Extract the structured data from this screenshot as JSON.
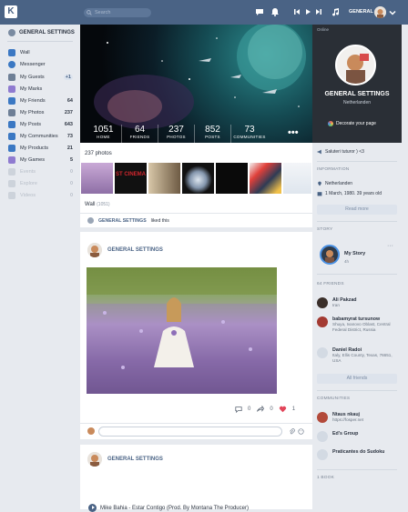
{
  "topbar": {
    "logo": "K",
    "search_placeholder": "Search",
    "username": "GENERAL",
    "colors": {
      "bar": "#4a6385",
      "accent": "#4a6385"
    }
  },
  "sidebar": {
    "user": "GENERAL SETTINGS",
    "items": [
      {
        "label": "Wall",
        "count": "",
        "icon": "wall-icon"
      },
      {
        "label": "Messenger",
        "count": "",
        "icon": "messenger-icon"
      },
      {
        "label": "My Guests",
        "count": "+1",
        "icon": "guests-icon"
      },
      {
        "label": "My Marks",
        "count": "",
        "icon": "marks-icon"
      },
      {
        "label": "My Friends",
        "count": "64",
        "icon": "friends-icon"
      },
      {
        "label": "My Photos",
        "count": "237",
        "icon": "photos-icon"
      },
      {
        "label": "My Posts",
        "count": "643",
        "icon": "posts-icon"
      },
      {
        "label": "My Communities",
        "count": "73",
        "icon": "communities-icon"
      },
      {
        "label": "My Products",
        "count": "21",
        "icon": "products-icon"
      },
      {
        "label": "My Games",
        "count": "5",
        "icon": "games-icon"
      },
      {
        "label": "Events",
        "count": "0",
        "icon": "events-icon"
      },
      {
        "label": "Explore",
        "count": "0",
        "icon": "explore-icon"
      },
      {
        "label": "Videos",
        "count": "0",
        "icon": "videos-icon"
      }
    ]
  },
  "stats": [
    {
      "value": "1051",
      "label": "HOME"
    },
    {
      "value": "64",
      "label": "FRIENDS"
    },
    {
      "value": "237",
      "label": "PHOTOS"
    },
    {
      "value": "852",
      "label": "POSTS"
    },
    {
      "value": "73",
      "label": "COMMUNITIES"
    }
  ],
  "photos_title": "237 photos",
  "wall": {
    "title": "Wall",
    "count": "(1051)"
  },
  "liked": {
    "name": "GENERAL SETTINGS",
    "text": "liked this"
  },
  "post1": {
    "author": "GENERAL SETTINGS",
    "comments": "0",
    "shares": "0",
    "likes": "1"
  },
  "post2": {
    "author": "GENERAL SETTINGS",
    "music": "Mike Bahia - Estar Contigo (Prod. By Montana The Producer)"
  },
  "profile": {
    "status": "Online",
    "name": "GENERAL SETTINGS",
    "location": "Netherlanden",
    "decorate": "Decorate your page"
  },
  "right": {
    "salute": "Saluteri tuturor ) <3",
    "information": "INFORMATION",
    "country": "Netherlanden",
    "birthday": "1 March, 1980. 39 years old",
    "read_more": "Read more",
    "story_title": "STORY",
    "story_name": "My Story",
    "story_time": "4h",
    "friends_title": "64 FRIENDS",
    "friends": [
      {
        "name": "Ali Pakzad",
        "sub": "Iran"
      },
      {
        "name": "babamyrat tursunow",
        "sub": "Shuya, Ivanovo Oblast, Central Federal District, Russia"
      },
      {
        "name": "Daniel Radoi",
        "sub": "Italy, Ellis County, Texas, 76651, USA"
      }
    ],
    "all_friends": "All friends",
    "communities_title": "COMMUNITIES",
    "communities": [
      {
        "name": "Ntaus nkauj",
        "sub": "https://fosper.net"
      },
      {
        "name": "Ed's Group",
        "sub": ""
      },
      {
        "name": "Praticantes do Sudoku",
        "sub": ""
      }
    ],
    "book_title": "1 BOOK"
  }
}
